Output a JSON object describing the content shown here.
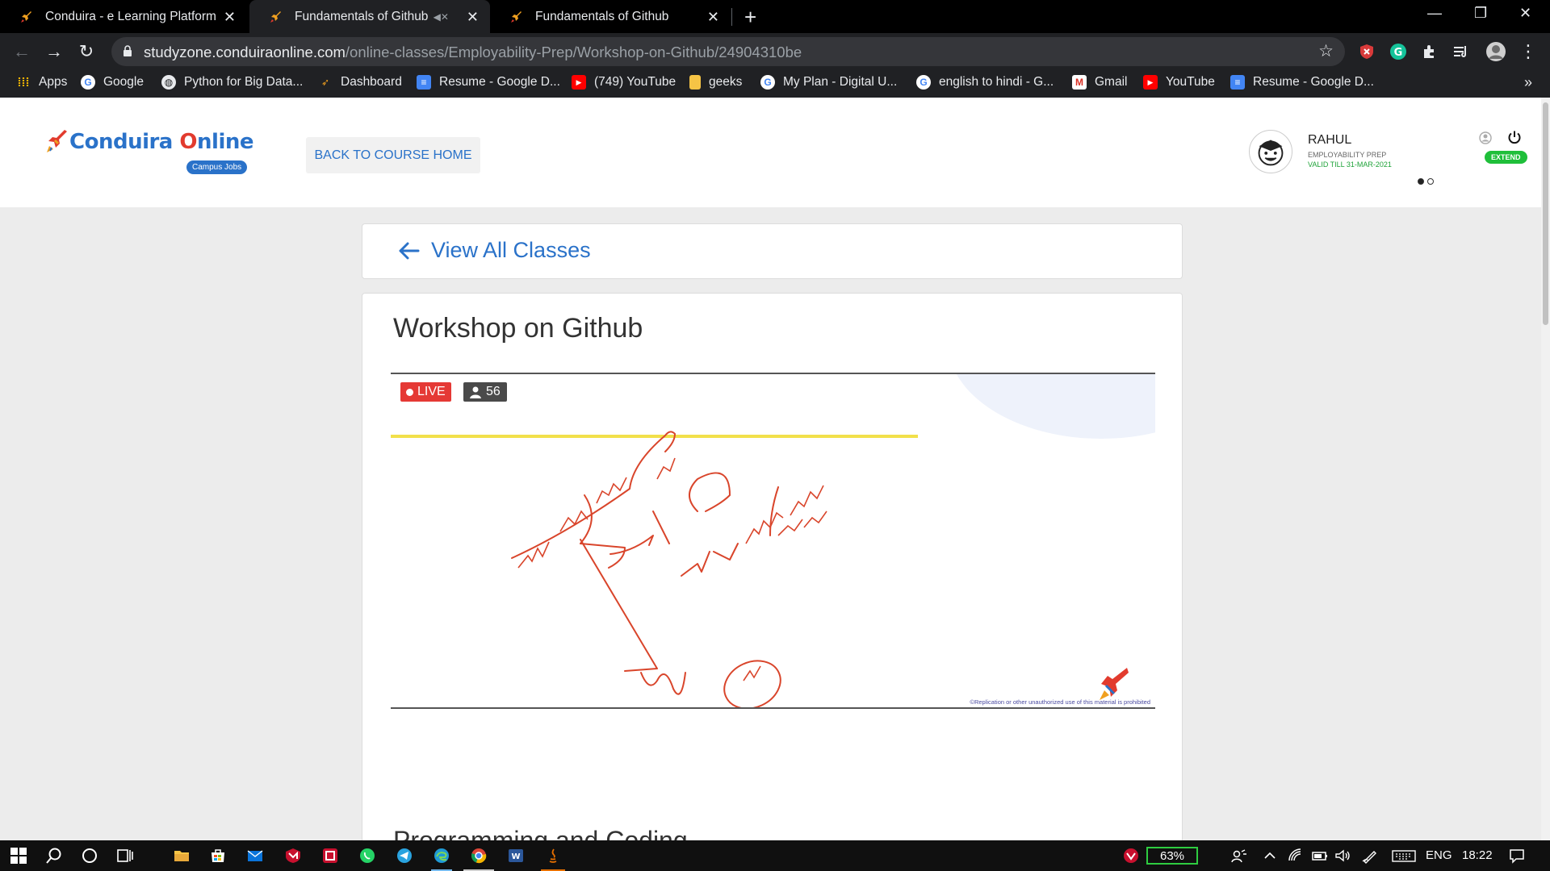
{
  "browser": {
    "tabs": [
      {
        "title": "Conduira - e Learning Platform -",
        "active": false
      },
      {
        "title": "Fundamentals of Github",
        "active": true,
        "muted": true
      },
      {
        "title": "Fundamentals of Github",
        "active": false
      }
    ],
    "url_host": "studyzone.conduiraonline.com",
    "url_path": "/online-classes/Employability-Prep/Workshop-on-Github/24904310be",
    "bookmarks": [
      {
        "label": "Apps",
        "icon": "apps-grid-icon"
      },
      {
        "label": "Google",
        "icon": "google-icon"
      },
      {
        "label": "Python for Big Data...",
        "icon": "globe-icon"
      },
      {
        "label": "Dashboard",
        "icon": "conduira-icon"
      },
      {
        "label": "Resume - Google D...",
        "icon": "google-docs-icon"
      },
      {
        "label": "(749) YouTube",
        "icon": "youtube-icon"
      },
      {
        "label": "geeks",
        "icon": "folder-icon"
      },
      {
        "label": "My Plan - Digital U...",
        "icon": "google-icon"
      },
      {
        "label": "english to hindi - G...",
        "icon": "google-icon"
      },
      {
        "label": "Gmail",
        "icon": "gmail-icon"
      },
      {
        "label": "YouTube",
        "icon": "youtube-icon"
      },
      {
        "label": "Resume - Google D...",
        "icon": "google-docs-icon"
      }
    ]
  },
  "site": {
    "logo_prefix": "Conduira ",
    "logo_o": "O",
    "logo_suffix": "nline",
    "logo_badge": "Campus Jobs",
    "back_button": "BACK TO COURSE HOME",
    "user": {
      "name": "RAHUL",
      "plan": "EMPLOYABILITY PREP",
      "valid": "VALID TILL 31-MAR-2021",
      "extend": "EXTEND"
    }
  },
  "main": {
    "view_all": "View All Classes",
    "workshop_title": "Workshop on Github",
    "live_label": "LIVE",
    "viewer_count": "56",
    "copyright": "©Replication or other unauthorized use of this material is prohibited",
    "next_section_title": "Programming and Coding"
  },
  "taskbar": {
    "battery": "63%",
    "language": "ENG",
    "time": "18:22"
  },
  "colors": {
    "brand_blue": "#2a72c9",
    "live_red": "#e53935",
    "extend_green": "#1fbf3a",
    "ink_red": "#d9452b",
    "browser_dark": "#202124"
  }
}
